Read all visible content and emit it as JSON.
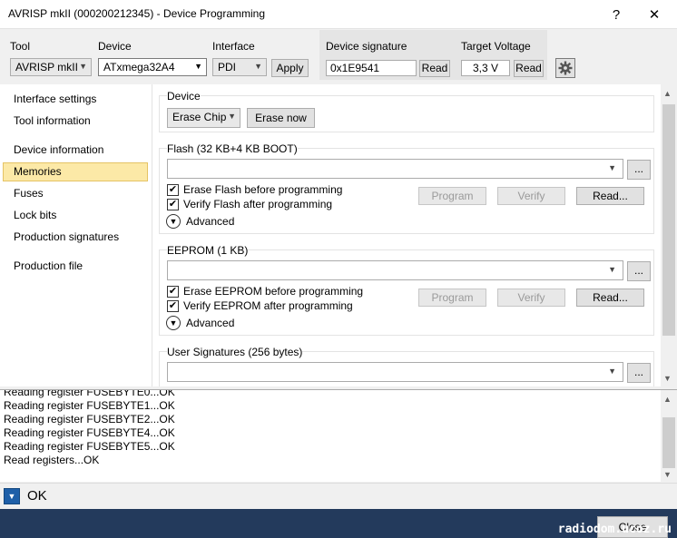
{
  "window": {
    "title": "AVRISP mkII (000200212345) - Device Programming",
    "help": "?",
    "close": "✕"
  },
  "toolbar": {
    "tool_label": "Tool",
    "tool_value": "AVRISP mkII",
    "device_label": "Device",
    "device_value": "ATxmega32A4",
    "interface_label": "Interface",
    "interface_value": "PDI",
    "apply": "Apply",
    "signature_label": "Device signature",
    "signature_value": "0x1E9541",
    "signature_read": "Read",
    "voltage_label": "Target Voltage",
    "voltage_value": "3,3 V",
    "voltage_read": "Read"
  },
  "sidebar": {
    "items": [
      {
        "label": "Interface settings"
      },
      {
        "label": "Tool information"
      },
      {
        "label": "Device information"
      },
      {
        "label": "Memories"
      },
      {
        "label": "Fuses"
      },
      {
        "label": "Lock bits"
      },
      {
        "label": "Production signatures"
      },
      {
        "label": "Production file"
      }
    ]
  },
  "device_group": {
    "title": "Device",
    "erase_select": "Erase Chip",
    "erase_now": "Erase now"
  },
  "flash_group": {
    "title": "Flash (32 KB+4 KB BOOT)",
    "file_value": "",
    "browse": "...",
    "erase_check": "Erase Flash before programming",
    "verify_check": "Verify Flash after programming",
    "advanced": "Advanced",
    "program": "Program",
    "verify": "Verify",
    "read": "Read..."
  },
  "eeprom_group": {
    "title": "EEPROM (1 KB)",
    "file_value": "",
    "browse": "...",
    "erase_check": "Erase EEPROM before programming",
    "verify_check": "Verify EEPROM after programming",
    "advanced": "Advanced",
    "program": "Program",
    "verify": "Verify",
    "read": "Read..."
  },
  "usersig_group": {
    "title": "User Signatures (256 bytes)",
    "file_value": "",
    "browse": "..."
  },
  "log": {
    "lines": [
      "Reading register FUSEBYTE0...OK",
      "Reading register FUSEBYTE1...OK",
      "Reading register FUSEBYTE2...OK",
      "Reading register FUSEBYTE4...OK",
      "Reading register FUSEBYTE5...OK",
      "Read registers...OK"
    ]
  },
  "status": {
    "text": "OK"
  },
  "footer": {
    "close": "Close",
    "watermark": "radiodom.ucoz.ru"
  }
}
